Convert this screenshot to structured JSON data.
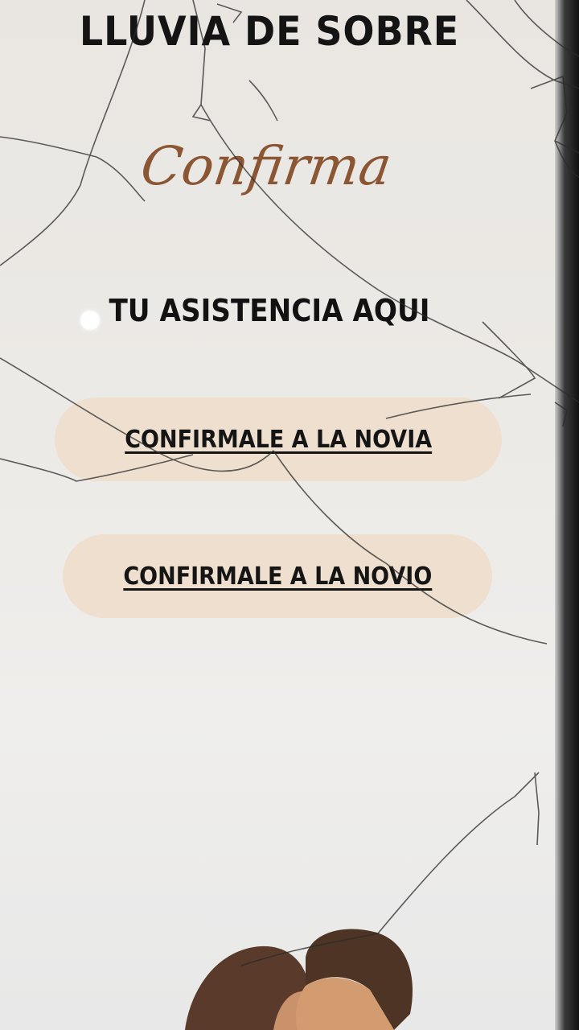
{
  "header": {
    "title": "LLUVIA DE SOBRE",
    "script_title": "Confirma"
  },
  "main": {
    "subtitle": "TU ASISTENCIA AQUI",
    "buttons": [
      {
        "label": "CONFIRMALE A LA NOVIA"
      },
      {
        "label": "CONFIRMALE A LA NOVIO"
      }
    ]
  },
  "colors": {
    "background": "#ebe8e4",
    "script_accent": "#8b5634",
    "button_fill": "#efdfcf",
    "text": "#141414"
  },
  "icons": {
    "dot": "white-dot-icon",
    "illustration": "couple-kiss-illustration"
  }
}
